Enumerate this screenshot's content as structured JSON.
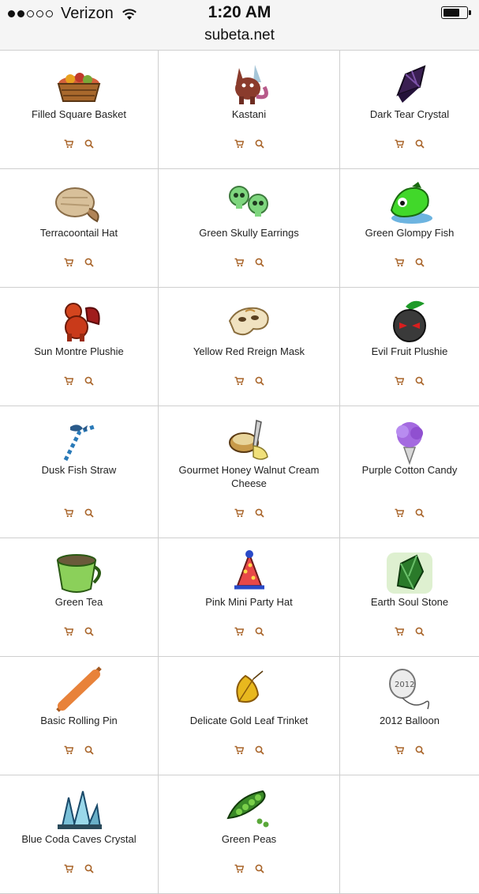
{
  "status_bar": {
    "signal_dots_filled": 2,
    "signal_dots_total": 5,
    "carrier": "Verizon",
    "time": "1:20 AM",
    "battery_level": 0.6,
    "url": "subeta.net"
  },
  "items": [
    {
      "name": "Filled Square Basket",
      "icon": "basket-icon"
    },
    {
      "name": "Kastani",
      "icon": "kastani-pet-icon"
    },
    {
      "name": "Dark Tear Crystal",
      "icon": "dark-crystal-icon"
    },
    {
      "name": "Terracoontail Hat",
      "icon": "fur-hat-icon"
    },
    {
      "name": "Green Skully Earrings",
      "icon": "skull-earrings-icon"
    },
    {
      "name": "Green Glompy Fish",
      "icon": "green-fish-icon"
    },
    {
      "name": "Sun Montre Plushie",
      "icon": "plushie-icon"
    },
    {
      "name": "Yellow Red Rreign Mask",
      "icon": "mask-icon"
    },
    {
      "name": "Evil Fruit Plushie",
      "icon": "evil-fruit-icon"
    },
    {
      "name": "Dusk Fish Straw",
      "icon": "straw-icon"
    },
    {
      "name": "Gourmet Honey Walnut Cream Cheese",
      "icon": "cream-cheese-icon"
    },
    {
      "name": "Purple Cotton Candy",
      "icon": "cotton-candy-icon"
    },
    {
      "name": "Green Tea",
      "icon": "tea-cup-icon"
    },
    {
      "name": "Pink Mini Party Hat",
      "icon": "party-hat-icon"
    },
    {
      "name": "Earth Soul Stone",
      "icon": "soul-stone-icon"
    },
    {
      "name": "Basic Rolling Pin",
      "icon": "rolling-pin-icon"
    },
    {
      "name": "Delicate Gold Leaf Trinket",
      "icon": "gold-leaf-icon"
    },
    {
      "name": "2012 Balloon",
      "icon": "balloon-icon"
    },
    {
      "name": "Blue Coda Caves Crystal",
      "icon": "blue-crystal-icon"
    },
    {
      "name": "Green Peas",
      "icon": "peas-icon"
    }
  ],
  "actions": {
    "cart_icon": "cart-icon",
    "search_icon": "search-icon",
    "color": "#a9652a"
  },
  "colors": {
    "grid_line": "#cfcfcf",
    "status_bg": "#f5f5f5"
  }
}
